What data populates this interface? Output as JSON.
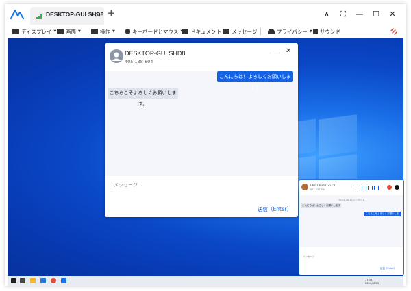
{
  "window": {
    "tab_title": "DESKTOP-GULSHD8",
    "tab_close": "×",
    "new_tab": "+",
    "controls": {
      "collapse": "∧",
      "fullscreen": "⛶",
      "minimize": "—",
      "maximize": "☐",
      "close": "✕"
    }
  },
  "toolbar": {
    "items": [
      {
        "label": "ディスプレイ",
        "icon": "monitor-icon",
        "dropdown": true
      },
      {
        "label": "画面",
        "icon": "hd-icon",
        "dropdown": true
      },
      {
        "label": "操作",
        "icon": "keyboard-icon",
        "dropdown": true
      },
      {
        "label": "キーボードとマウス",
        "icon": "mouse-icon",
        "dropdown": true
      },
      {
        "label": "ドキュメント",
        "icon": "folder-icon",
        "dropdown": false
      },
      {
        "label": "メッセージ",
        "icon": "message-icon",
        "dropdown": false
      },
      {
        "label": "プライバシー",
        "icon": "umbrella-icon",
        "dropdown": true
      },
      {
        "label": "サウンド",
        "icon": "speaker-muted-icon",
        "dropdown": false
      }
    ],
    "disconnect_icon": "unlink-icon",
    "accent": "#e5433c"
  },
  "chat": {
    "title": "DESKTOP-GULSHD8",
    "subtitle": "405 138 604",
    "minimize": "—",
    "close": "✕",
    "messages": [
      {
        "from": "me",
        "text": "こんにちは！よろしくお願いします！"
      },
      {
        "from": "remote",
        "text": "こちらこそよろしくお願いします。"
      }
    ],
    "input_placeholder": "メッセージ...",
    "send_label": "送信（Enter）",
    "accent": "#1463e6"
  },
  "mini_chat": {
    "title": "LAPTOP-VFTGG710",
    "subtitle": "071 537 583",
    "date": "2024-08-15 17:40:41",
    "messages": [
      {
        "from": "remote",
        "text": "こんにちは！よろしくお願いします"
      },
      {
        "from": "me",
        "text": "こちらこそよろしくお願いします。"
      }
    ],
    "input_placeholder": "メッセージ...",
    "send_label": "送信（Enter）"
  },
  "taskbar": {
    "time": "17:38",
    "date": "2024/08/15"
  }
}
